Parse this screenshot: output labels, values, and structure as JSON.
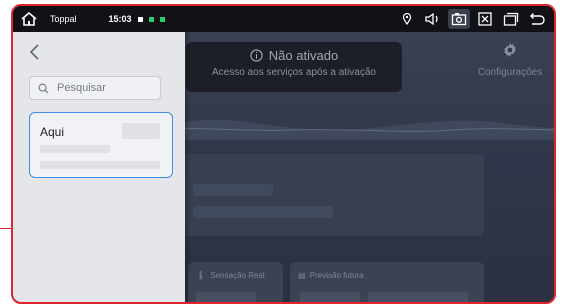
{
  "statusbar": {
    "app_name": "Toppal",
    "time": "15:03",
    "indicator_colors": [
      "#4aa3ff",
      "#2ecc71",
      "#2ecc71"
    ]
  },
  "notice": {
    "title": "Não ativado",
    "subtitle": "Acesso aos serviços após a ativação"
  },
  "settings": {
    "label": "Configurações"
  },
  "cards": [
    {
      "label": "Sensação Real"
    },
    {
      "label": "Previsão futura"
    }
  ],
  "search": {
    "placeholder": "Pesquisar"
  },
  "result": {
    "label": "Aqui"
  },
  "colors": {
    "accent": "#3d8ee8",
    "frame": "#e0252f"
  }
}
